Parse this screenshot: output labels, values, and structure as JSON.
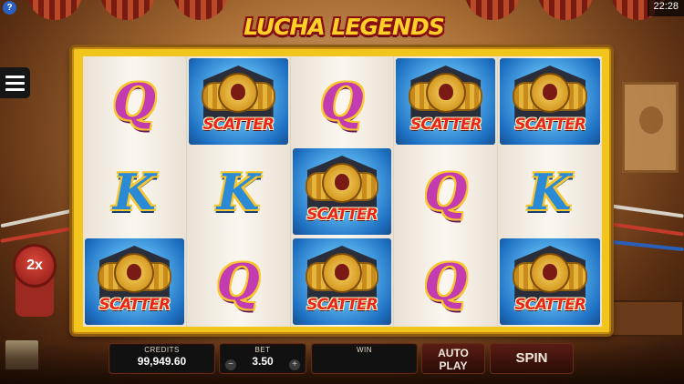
{
  "status_bar": {
    "time": "22:28"
  },
  "help_button": {
    "label": "?"
  },
  "menu_button": {
    "icon": "hamburger-menu-icon"
  },
  "logo": {
    "text": "LUCHA LEGENDS"
  },
  "multiplier": {
    "label": "2x"
  },
  "reels": [
    [
      "Q",
      "K",
      "SCATTER"
    ],
    [
      "SCATTER",
      "K",
      "Q"
    ],
    [
      "Q",
      "SCATTER",
      "SCATTER"
    ],
    [
      "SCATTER",
      "Q",
      "Q"
    ],
    [
      "SCATTER",
      "K",
      "SCATTER"
    ]
  ],
  "symbols": {
    "q_label": "Q",
    "k_label": "K",
    "scatter_label": "SCATTER"
  },
  "controls": {
    "credits_label": "CREDITS",
    "credits_value": "99,949.60",
    "bet_label": "BET",
    "bet_value": "3.50",
    "bet_minus": "−",
    "bet_plus": "+",
    "win_label": "WIN",
    "win_value": "",
    "autoplay_line1": "AUTO",
    "autoplay_line2": "PLAY",
    "spin_label": "SPIN"
  },
  "colors": {
    "frame": "#f2c51c",
    "scatter_bg": "#1d6fc1",
    "q_symbol": "#c23bb0",
    "k_symbol": "#2a8ad6",
    "scatter_text": "#e8251c"
  }
}
